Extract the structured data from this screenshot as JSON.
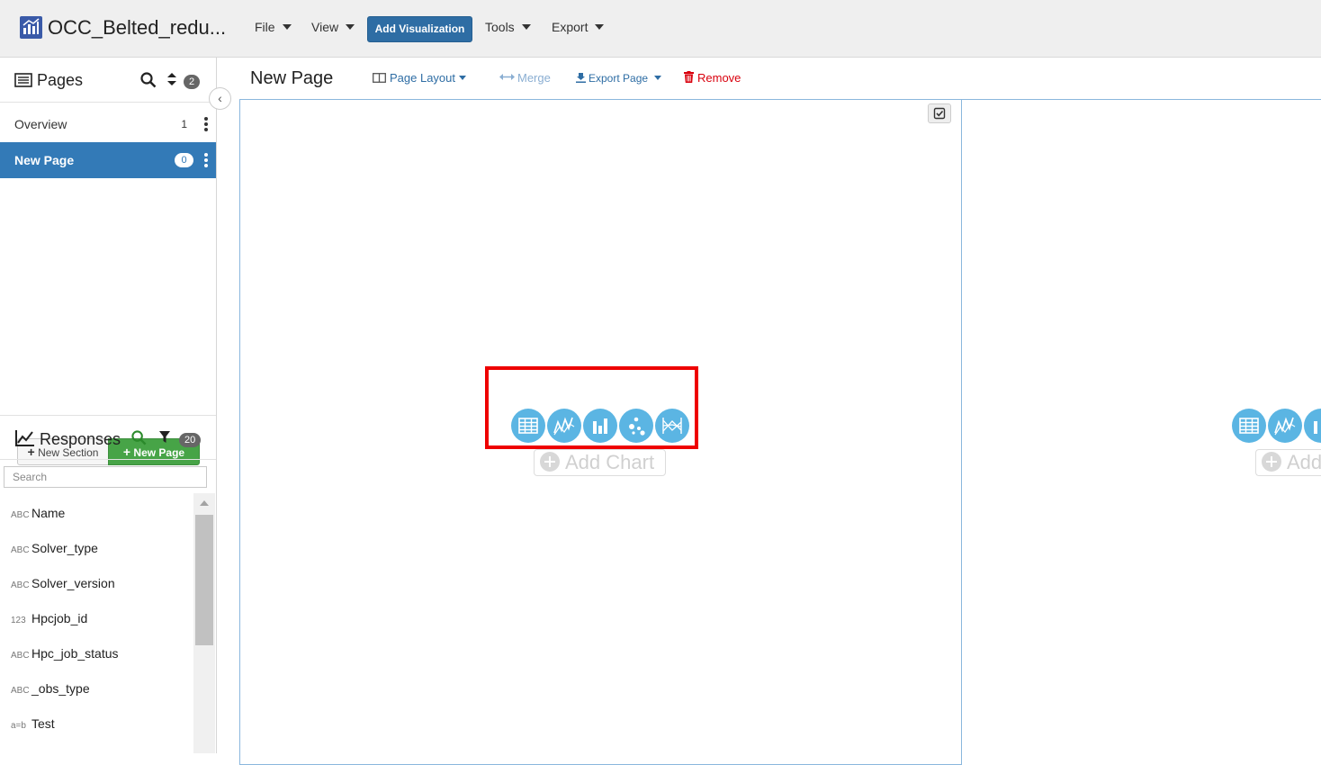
{
  "app": {
    "title": "OCC_Belted_redu...",
    "menus": [
      "File",
      "View",
      "Tools",
      "Export"
    ],
    "add_visualization": "Add Visualization"
  },
  "pages_panel": {
    "title": "Pages",
    "count": "2",
    "items": [
      {
        "label": "Overview",
        "count": "1"
      },
      {
        "label": "New Page",
        "count": "0"
      }
    ],
    "new_section": "New Section",
    "new_page": "New Page"
  },
  "responses_panel": {
    "title": "Responses",
    "count": "20",
    "search_placeholder": "Search",
    "fields": [
      {
        "type": "ABC",
        "name": "Name"
      },
      {
        "type": "ABC",
        "name": "Solver_type"
      },
      {
        "type": "ABC",
        "name": "Solver_version"
      },
      {
        "type": "123",
        "name": "Hpcjob_id"
      },
      {
        "type": "ABC",
        "name": "Hpc_job_status"
      },
      {
        "type": "ABC",
        "name": "_obs_type"
      },
      {
        "type": "a=b",
        "name": "Test"
      }
    ]
  },
  "page": {
    "title": "New Page",
    "toolbar": {
      "page_layout": "Page Layout",
      "merge": "Merge",
      "export_page": "Export Page",
      "remove": "Remove"
    },
    "add_chart_left": "Add Chart",
    "add_chart_right": "Add"
  },
  "colors": {
    "primary": "#337ab7",
    "success": "#47a447",
    "danger": "#d9000d",
    "chart_icon": "#5bb5e3",
    "highlight": "#ee0000"
  }
}
